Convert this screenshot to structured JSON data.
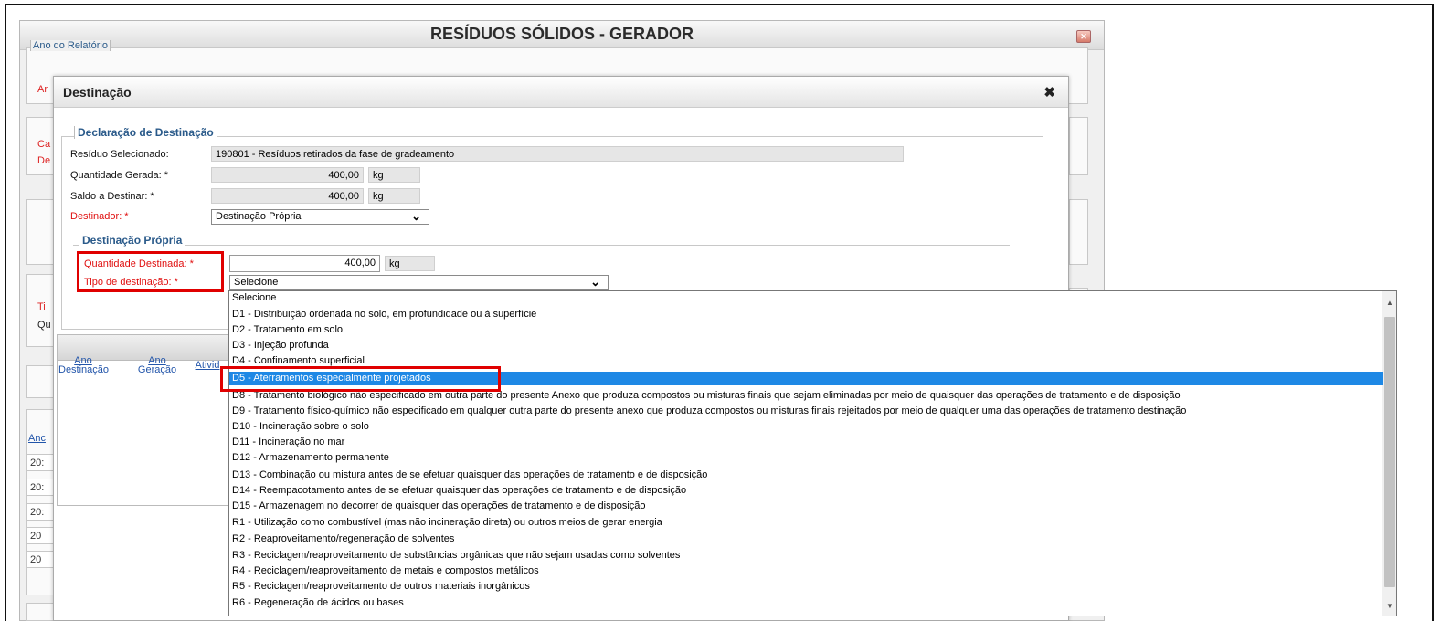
{
  "main_window": {
    "title": "RESÍDUOS SÓLIDOS - GERADOR",
    "close_label": "✕",
    "ano_legend": "Ano do Relatório",
    "partial_labels": [
      "Ar",
      "Ca",
      "De",
      "Ti",
      "Qu"
    ],
    "partial_years": [
      "20:",
      "20:",
      "20:",
      "20",
      "20"
    ],
    "partial_link": "Anc"
  },
  "dialog": {
    "title": "Destinação",
    "close_icon": "✖",
    "declaracao": {
      "legend": "Declaração de Destinação",
      "residuo_label": "Resíduo Selecionado:",
      "residuo_value": "190801 - Resíduos retirados da fase de gradeamento",
      "qtd_gerada_label": "Quantidade Gerada: *",
      "qtd_gerada_value": "400,00",
      "qtd_gerada_unit": "kg",
      "saldo_label": "Saldo a Destinar: *",
      "saldo_value": "400,00",
      "saldo_unit": "kg",
      "destinador_label": "Destinador: *",
      "destinador_value": "Destinação Própria"
    },
    "propria": {
      "legend": "Destinação Própria",
      "qtd_destinada_label": "Quantidade Destinada: *",
      "qtd_destinada_value": "400,00",
      "qtd_destinada_unit": "kg",
      "tipo_label": "Tipo de destinação: *",
      "tipo_value": "Selecione"
    },
    "grid": {
      "columns": [
        {
          "line1": "Ano",
          "line2": "Destinação"
        },
        {
          "line1": "Ano",
          "line2": "Geração"
        },
        {
          "line1": "Ativid",
          "line2": ""
        }
      ]
    }
  },
  "dropdown": {
    "selected_index": 5,
    "options": [
      "Selecione",
      "D1 - Distribuição ordenada no solo, em profundidade ou à superfície",
      "D2 - Tratamento em solo",
      "D3 - Injeção profunda",
      "D4 - Confinamento superficial",
      "D5 - Aterramentos especialmente projetados",
      "D8 - Tratamento biológico não especificado em outra parte do presente Anexo que produza compostos ou misturas finais que sejam eliminadas por meio de quaisquer das operações de tratamento e de disposição",
      "D9 - Tratamento físico-químico não especificado em qualquer outra parte do presente anexo que produza compostos ou misturas finais rejeitados por meio de qualquer uma das operações de tratamento destinação",
      "D10 - Incineração sobre o solo",
      "D11 - Incineração no mar",
      "D12 - Armazenamento permanente",
      "D13 - Combinação ou mistura antes de se efetuar quaisquer das operações de tratamento e de disposição",
      "D14 - Reempacotamento antes de se efetuar quaisquer das operações de tratamento e de disposição",
      "D15 - Armazenagem no decorrer de quaisquer das operações de tratamento e de disposição",
      "R1 - Utilização como combustível (mas não incineração direta) ou outros meios de gerar energia",
      "R2 - Reaproveitamento/regeneração de solventes",
      "R3 - Reciclagem/reaproveitamento de substâncias orgânicas que não sejam usadas como solventes",
      "R4 - Reciclagem/reaproveitamento de metais e compostos metálicos",
      "R5 - Reciclagem/reaproveitamento de outros materiais inorgânicos",
      "R6 - Regeneração de ácidos ou bases"
    ]
  },
  "colors": {
    "highlight_red": "#e00000",
    "selected_blue": "#1e88e5",
    "legend_blue": "#2a5a8a",
    "required_red": "#e01010"
  }
}
